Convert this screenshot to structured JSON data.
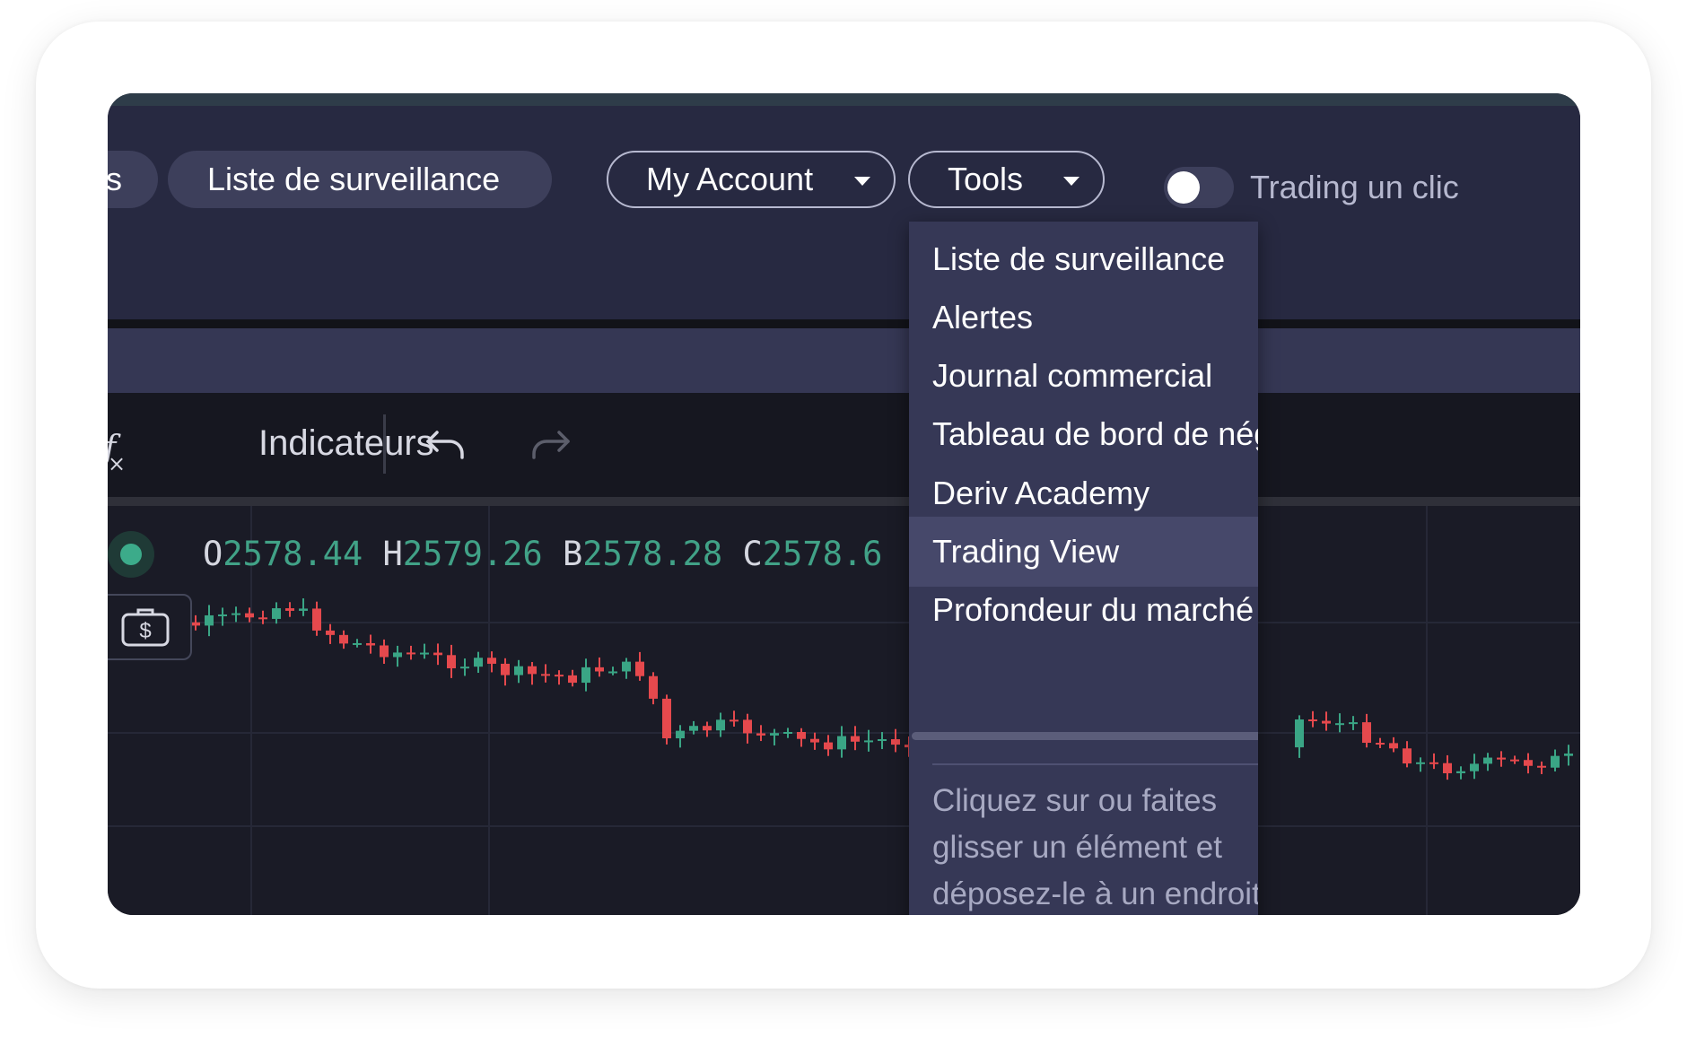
{
  "header": {
    "partial_tab_label": "s",
    "watchlist_button": "Liste de surveillance",
    "account_button": "My Account",
    "tools_button": "Tools",
    "one_click_toggle_label": "Trading un clic",
    "one_click_enabled": false
  },
  "toolbar": {
    "indicators_label": "Indicateurs",
    "fx_icon_text": "f",
    "fx_icon_sub": "×"
  },
  "ohlc": {
    "open_key": "O",
    "open": "2578.44",
    "high_key": "H",
    "high": "2579.26",
    "low_key": "B",
    "low": "2578.28",
    "close_key": "C",
    "close": "2578.6"
  },
  "tools_menu": {
    "items": [
      {
        "label": "Liste de surveillance"
      },
      {
        "label": "Alertes"
      },
      {
        "label": "Journal commercial"
      },
      {
        "label": "Tableau de bord de négocia"
      },
      {
        "label": "Deriv Academy"
      },
      {
        "label": "Trading View",
        "highlighted": true
      },
      {
        "label": "Profondeur du marché"
      }
    ],
    "hint": "Cliquez sur ou faites glisser un élément et déposez-le à un endroit"
  },
  "chart_data": {
    "type": "candlestick",
    "up_color": "#3aa585",
    "down_color": "#e5494d",
    "grid": true
  },
  "colors": {
    "header_bg": "#272941",
    "menu_bg": "#363856",
    "menu_highlight": "#46486a",
    "price_green": "#41a287"
  }
}
